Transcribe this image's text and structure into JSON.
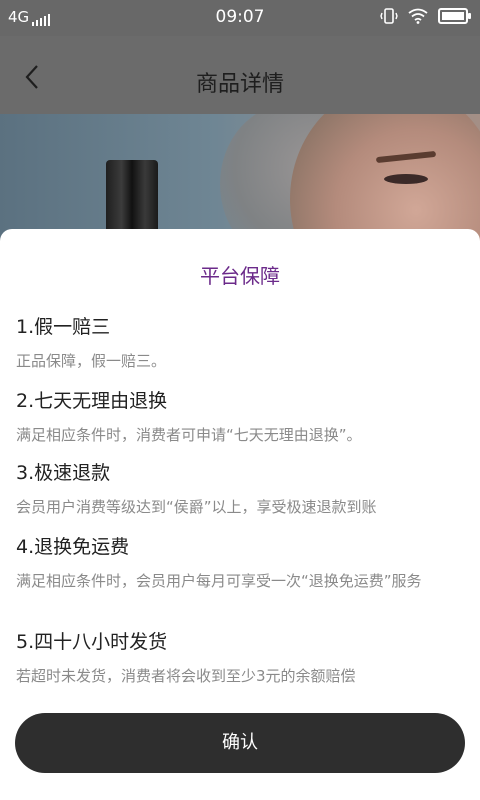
{
  "status_bar": {
    "network": "4G",
    "time": "09:07"
  },
  "nav": {
    "title": "商品详情"
  },
  "sheet": {
    "title": "平台保障",
    "items": [
      {
        "title": "1.假一赔三",
        "desc": "正品保障，假一赔三。"
      },
      {
        "title": "2.七天无理由退换",
        "desc": "满足相应条件时，消费者可申请“七天无理由退换”。"
      },
      {
        "title": "3.极速退款",
        "desc": "会员用户消费等级达到“侯爵”以上，享受极速退款到账"
      },
      {
        "title": "4.退换免运费",
        "desc": "满足相应条件时，会员用户每月可享受一次“退换免运费”服务"
      },
      {
        "title": "5.四十八小时发货",
        "desc": "若超时未发货，消费者将会收到至少3元的余额赔偿"
      }
    ],
    "confirm_label": "确认"
  },
  "colors": {
    "accent": "#6b2a8a",
    "button_bg": "#2e2e2e"
  }
}
